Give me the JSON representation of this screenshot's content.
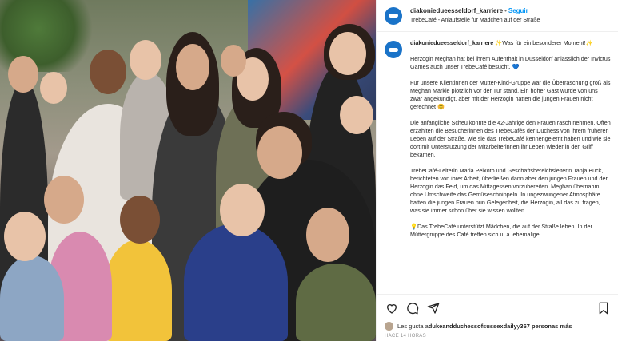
{
  "post": {
    "username": "diakoniedueesseldorf_karriere",
    "follow_label": "Seguir",
    "location": "TrebeCafé - Anlaufstelle für Mädchen auf der Straße"
  },
  "caption": {
    "username": "diakoniedueesseldorf_karriere",
    "paragraphs": [
      "✨Was für ein besonderer Moment!✨",
      "Herzogin Meghan hat bei ihrem Aufenthalt in Düsseldorf anlässlich der Invictus Games auch unser TrebeCafé besucht. 💙",
      "Für unsere Klientinnen der Mutter-Kind-Gruppe war die Überraschung groß als Meghan Markle plötzlich vor der Tür stand. Ein hoher Gast wurde von uns zwar angekündigt, aber mit der Herzogin hatten die jungen Frauen nicht gerechnet 😊",
      "Die anfängliche Scheu konnte die 42-Jährige den Frauen rasch nehmen. Offen erzählten die Besucherinnen des TrebeCafés der Duchess von ihrem früheren Leben auf der Straße, wie sie das TrebeCafé kennengelernt haben und wie sie dort mit Unterstützung der Mitarbeiterinnen ihr Leben wieder in den Griff bekamen.",
      "TrebeCafé-Leiterin Maria Peixoto und Geschäftsbereichsleiterin Tanja Buck, berichteten von ihrer Arbeit, überließen dann aber den jungen Frauen und der Herzogin das Feld, um das Mittagessen vorzubereiten. Meghan übernahm ohne Umschweife das Gemüseschnippeln. In ungezwungener Atmosphäre hatten die jungen Frauen nun Gelegenheit, die Herzogin, all das zu fragen, was sie immer schon über sie wissen wollten.",
      "💡Das TrebeCafé unterstützt Mädchen, die auf der Straße leben. In der Müttergruppe des Café treffen sich u. a. ehemalige"
    ]
  },
  "actions": {
    "like_icon": "heart-icon",
    "comment_icon": "comment-icon",
    "share_icon": "share-icon",
    "save_icon": "bookmark-icon"
  },
  "likes": {
    "prefix": "Les gusta a ",
    "first_user": "dukeandduchessofsussexdaily",
    "middle": " y ",
    "others": "367 personas más"
  },
  "timestamp": "HACE 14 HORAS",
  "colors": {
    "follow": "#0095f6",
    "avatar": "#1a73c8"
  }
}
